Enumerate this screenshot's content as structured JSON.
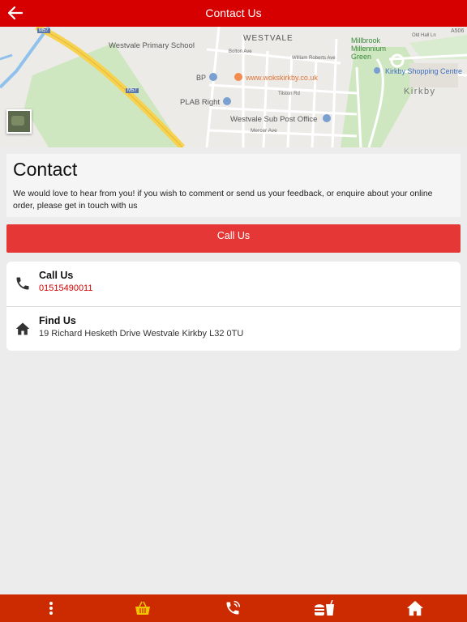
{
  "header": {
    "title": "Contact Us"
  },
  "map": {
    "labels": {
      "road_m57_a": "M57",
      "road_m57_b": "M57",
      "westvale": "WESTVALE",
      "school": "Westvale Primary School",
      "bolton": "Bolton Ave",
      "william": "William Roberts Ave",
      "bp": "BP",
      "woks": "www.wokskirkby.co.uk",
      "plab": "PLAB Right",
      "post_office": "Westvale Sub Post Office",
      "mercer": "Mercer Ave",
      "millbrook": "Millbrook\nMillennium\nGreen",
      "kirkby_sc": "Kirkby Shopping Centre",
      "kirkby": "Kirkby",
      "old_hall": "Old Hall Ln",
      "a506": "A506",
      "tilston": "Tilston Rd"
    }
  },
  "intro": {
    "heading": "Contact",
    "body": "We would love to hear from you! if you wish to comment or send us your feedback, or enquire about your online order, please get in touch with us"
  },
  "call_button": {
    "label": "Call Us"
  },
  "contacts": [
    {
      "heading": "Call Us",
      "value": "01515490011",
      "icon": "phone-icon"
    },
    {
      "heading": "Find Us",
      "value": "19 Richard Hesketh Drive Westvale Kirkby L32 0TU",
      "icon": "home-icon"
    }
  ],
  "bottom_nav": [
    {
      "name": "more-menu",
      "icon": "vertical-dots-icon"
    },
    {
      "name": "basket",
      "icon": "basket-icon",
      "color": "#f2c200"
    },
    {
      "name": "call",
      "icon": "phone-ringing-icon"
    },
    {
      "name": "menu",
      "icon": "burger-drink-icon"
    },
    {
      "name": "home",
      "icon": "home-icon"
    }
  ],
  "colors": {
    "header_bg": "#d60000",
    "call_button_bg": "#e63737",
    "bottom_bar_bg": "#cc2a00",
    "phone_text": "#d60000",
    "active_tab": "#f2c200"
  }
}
